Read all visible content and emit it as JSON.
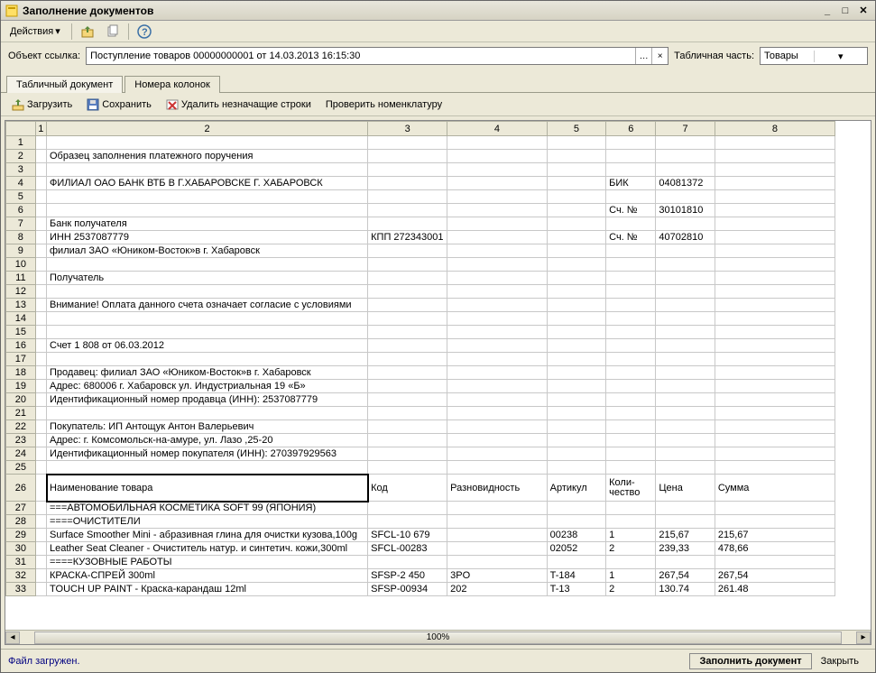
{
  "window": {
    "title": "Заполнение документов"
  },
  "menu": {
    "actions": "Действия"
  },
  "ref": {
    "label": "Объект ссылка:",
    "value": "Поступление товаров 00000000001 от 14.03.2013 16:15:30",
    "tab_label": "Табличная часть:",
    "tab_value": "Товары"
  },
  "tabs": {
    "doc": "Табличный документ",
    "cols": "Номера колонок"
  },
  "toolbar": {
    "load": "Загрузить",
    "save": "Сохранить",
    "del": "Удалить незначащие строки",
    "check": "Проверить номенклатуру"
  },
  "cols": [
    "",
    "1",
    "2",
    "3",
    "4",
    "5",
    "6",
    "7",
    "8"
  ],
  "rows": [
    {
      "n": "1"
    },
    {
      "n": "2",
      "c2": "Образец заполнения платежного поручения"
    },
    {
      "n": "3"
    },
    {
      "n": "4",
      "c2": "ФИЛИАЛ ОАО БАНК ВТБ В Г.ХАБАРОВСКЕ Г. ХАБАРОВСК",
      "c6": "БИК",
      "c7": "04081372"
    },
    {
      "n": "5"
    },
    {
      "n": "6",
      "c6": "Сч. №",
      "c7": "30101810"
    },
    {
      "n": "7",
      "c2": "Банк получателя"
    },
    {
      "n": "8",
      "c2": "ИНН  2537087779",
      "c3": "КПП  272343001",
      "c6": "Сч. №",
      "c7": "40702810"
    },
    {
      "n": "9",
      "c2": "филиал ЗАО «Юником-Восток»в  г. Хабаровск"
    },
    {
      "n": "10"
    },
    {
      "n": "11",
      "c2": "Получатель"
    },
    {
      "n": "12"
    },
    {
      "n": "13",
      "c2": "Внимание! Оплата данного счета означает согласие с условиями"
    },
    {
      "n": "14"
    },
    {
      "n": "15"
    },
    {
      "n": "16",
      "c2": "Счет 1 808 от 06.03.2012"
    },
    {
      "n": "17"
    },
    {
      "n": "18",
      "c2": "Продавец: филиал ЗАО «Юником-Восток»в  г. Хабаровск"
    },
    {
      "n": "19",
      "c2": "Адрес:  680006 г. Хабаровск ул. Индустриальная 19 «Б»"
    },
    {
      "n": "20",
      "c2": "Идентификационный номер продавца (ИНН):  2537087779"
    },
    {
      "n": "21"
    },
    {
      "n": "22",
      "c2": "Покупатель: ИП Антощук Антон Валерьевич"
    },
    {
      "n": "23",
      "c2": "Адрес: г. Комсомольск-на-амуре, ул. Лазо ,25-20"
    },
    {
      "n": "24",
      "c2": "Идентификационный номер покупателя (ИНН): 270397929563"
    },
    {
      "n": "25"
    },
    {
      "n": "26",
      "c2": "Наименование товара",
      "c3": "Код",
      "c4": "Разновидность",
      "c5": "Артикул",
      "c6": "Коли-\nчество",
      "c7": "Цена",
      "c8": "Сумма",
      "head": true
    },
    {
      "n": "27",
      "c2": "===АВТОМОБИЛЬНАЯ КОСМЕТИКА SOFT 99 (ЯПОНИЯ)"
    },
    {
      "n": "28",
      "c2": "        ====ОЧИСТИТЕЛИ"
    },
    {
      "n": "29",
      "c2": "Surface Smoother Mini - абразивная глина для очистки кузова,100g",
      "c3": "SFCL-10 679",
      "c5": "00238",
      "c6": "1",
      "c7": "215,67",
      "c8": "215,67"
    },
    {
      "n": "30",
      "c2": "Leather Seat Cleaner - Очиститель натур. и синтетич. кожи,300ml",
      "c3": "SFCL-00283",
      "c5": "02052",
      "c6": "2",
      "c7": "239,33",
      "c8": "478,66"
    },
    {
      "n": "31",
      "c2": "        ====КУЗОВНЫЕ РАБОТЫ"
    },
    {
      "n": "32",
      "c2": "КРАСКА-СПРЕЙ 300ml",
      "c3": "SFSP-2 450",
      "c4": "3PO",
      "c5": "T-184",
      "c6": "1",
      "c7": "267,54",
      "c8": "267,54"
    },
    {
      "n": "33",
      "c2": "TOUCH UP PAINT - Краска-карандаш 12ml",
      "c3": "SFSP-00934",
      "c4": "202",
      "c5": "T-13",
      "c6": "2",
      "c7": "130.74",
      "c8": "261.48"
    }
  ],
  "scroll_pct": "100%",
  "status": {
    "msg": "Файл загружен.",
    "fill": "Заполнить документ",
    "close": "Закрыть"
  }
}
